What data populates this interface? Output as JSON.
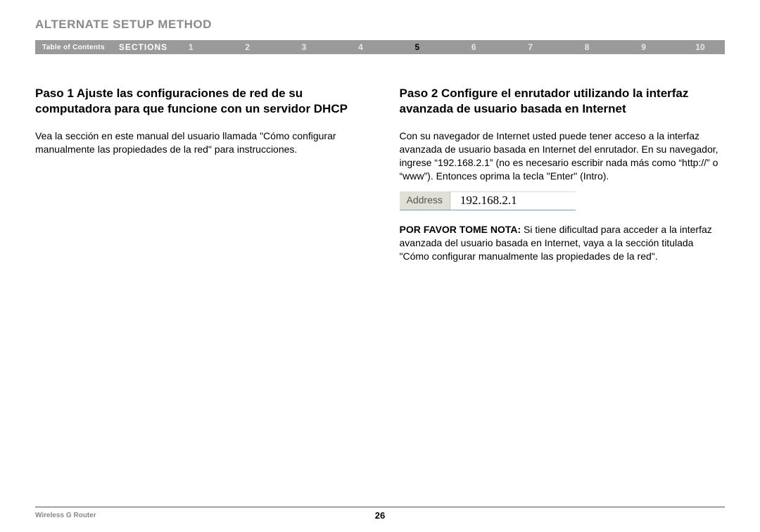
{
  "header": {
    "title": "ALTERNATE SETUP METHOD"
  },
  "nav": {
    "toc": "Table of Contents",
    "sections_label": "SECTIONS",
    "numbers": [
      "1",
      "2",
      "3",
      "4",
      "5",
      "6",
      "7",
      "8",
      "9",
      "10"
    ],
    "active": "5"
  },
  "left": {
    "heading": "Paso 1 Ajuste las configuraciones de red de su computadora para que funcione con un servidor DHCP",
    "body": "Vea la sección en este manual del usuario llamada \"Cómo configurar manualmente las propiedades de la red\" para instrucciones."
  },
  "right": {
    "heading": "Paso 2 Configure el enrutador utilizando la interfaz avanzada de usuario basada en Internet",
    "body": "Con su navegador de Internet usted puede tener acceso a la interfaz avanzada de usuario basada en Internet del enrutador. En su navegador, ingrese “192.168.2.1” (no es necesario escribir nada más como “http://” o “www”). Entonces oprima la tecla \"Enter\" (Intro).",
    "address_label": "Address",
    "address_value": "192.168.2.1",
    "note_label": "POR FAVOR TOME NOTA:",
    "note_body": " Si tiene dificultad para acceder a la interfaz avanzada del usuario basada en Internet, vaya a la sección titulada \"Cómo configurar manualmente las propiedades de la red\"."
  },
  "footer": {
    "left": "Wireless G Router",
    "page": "26"
  }
}
